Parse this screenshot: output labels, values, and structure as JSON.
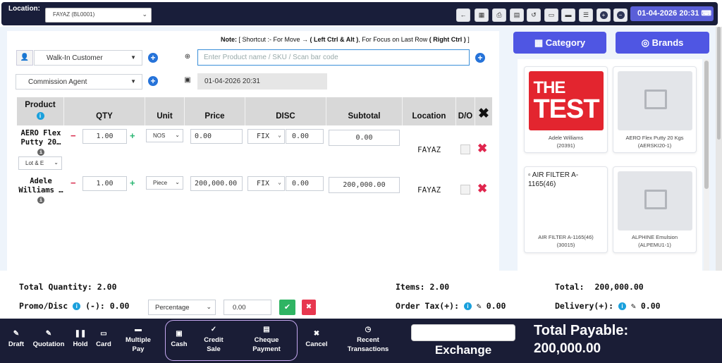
{
  "header": {
    "location_label": "Location:",
    "location_value": "FAYAZ (BL0001)",
    "datetime": "01-04-2026 20:31",
    "toolbar_icons": [
      "arrow-left-icon",
      "calculator-icon",
      "print-icon",
      "clipboard-icon",
      "undo-icon",
      "window-icon",
      "monitor-icon",
      "list-icon",
      "plus-circle-icon",
      "minus-circle-icon"
    ]
  },
  "note": {
    "prefix": "Note:",
    "text_a": " [ Shortcut :- For Move → ",
    "bold_a": "( Left Ctrl & Alt )",
    "text_b": ", For Focus on Last Row ",
    "bold_b": "( Right Ctrl )",
    "text_c": " ]"
  },
  "customer": {
    "value": "Walk-In Customer"
  },
  "agent": {
    "value": "Commission Agent"
  },
  "search": {
    "placeholder": "Enter Product name / SKU / Scan bar code"
  },
  "sale_date": "01-04-2026 20:31",
  "table": {
    "headers": {
      "product": "Product",
      "qty": "QTY",
      "unit": "Unit",
      "price": "Price",
      "disc": "DISC",
      "subtotal": "Subtotal",
      "location": "Location",
      "do": "D/O"
    },
    "rows": [
      {
        "name_l1": "AERO Flex",
        "name_l2": "Putty 20…",
        "lot": "Lot & E",
        "qty": "1.00",
        "unit": "NOS",
        "price": "0.00",
        "disc_type": "FIX",
        "disc_value": "0.00",
        "subtotal": "0.00",
        "location": "FAYAZ"
      },
      {
        "name_l1": "Adele",
        "name_l2": "Williams …",
        "qty": "1.00",
        "unit": "Piece",
        "price": "200,000.00",
        "disc_type": "FIX",
        "disc_value": "0.00",
        "subtotal": "200,000.00",
        "location": "FAYAZ"
      }
    ]
  },
  "side": {
    "category_label": "Category",
    "brands_label": "Brands",
    "products": [
      {
        "name": "Adele Williams",
        "code": "(20391)",
        "logo_text": "THE TEST",
        "brand_color": "#e3252f"
      },
      {
        "name": "AERO Flex Putty 20 Kgs",
        "code": "(AERSKI20-1)"
      },
      {
        "name": "AIR FILTER A-1165(46)",
        "code": "(30015)",
        "alt_text": "AIR FILTER A-1165(46)"
      },
      {
        "name": "ALPHINE Emulsion",
        "code": "(ALPEMU1-1)"
      }
    ]
  },
  "summary": {
    "total_quantity_label": "Total Quantity:",
    "total_quantity": "2.00",
    "items_label": "Items:",
    "items": "2.00",
    "total_label": "Total:",
    "total": "200,000.00",
    "promo_label": "Promo/Disc",
    "promo_minus": "(-): 0.00",
    "disc_type": "Percentage",
    "disc_value": "0.00",
    "order_tax_label": "Order Tax(+):",
    "order_tax": "0.00",
    "delivery_label": "Delivery(+):",
    "delivery": "0.00"
  },
  "footer": {
    "draft": "Draft",
    "quotation": "Quotation",
    "hold": "Hold",
    "card": "Card",
    "multiple_pay_l1": "Multiple",
    "multiple_pay_l2": "Pay",
    "cash": "Cash",
    "credit_sale_l1": "Credit",
    "credit_sale_l2": "Sale",
    "cheque_l1": "Cheque",
    "cheque_l2": "Payment",
    "cancel": "Cancel",
    "recent_l1": "Recent",
    "recent_l2": "Transactions",
    "exchange": "Exchange",
    "total_payable_label": "Total Payable:",
    "total_payable": "200,000.00"
  }
}
